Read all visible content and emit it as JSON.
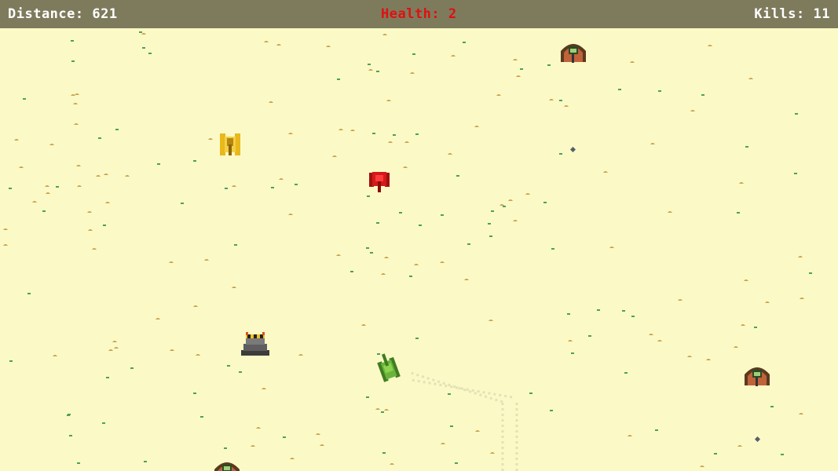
{
  "hud": {
    "distance_label": "Distance:",
    "distance_value": "621",
    "health_label": "Health:",
    "health_value": "2",
    "kills_label": "Kills:",
    "kills_value": "11"
  },
  "colors": {
    "sand": "#fbf9c6",
    "hud_bar": "#7e7b5d",
    "hud_text": "#ffffff",
    "health_text": "#e01010",
    "player_tank": "#6ab43c",
    "enemy_red_tank": "#d21a1a",
    "enemy_yellow_tank": "#e8b81c",
    "bunker": "#5a3a1e",
    "barricade": "#555555"
  },
  "entities": {
    "player": {
      "icon": "green-player-tank-icon"
    },
    "enemies": [
      {
        "icon": "red-enemy-tank-icon"
      },
      {
        "icon": "yellow-enemy-tank-icon"
      }
    ],
    "bunkers": [
      {
        "icon": "soldier-bunker-icon"
      },
      {
        "icon": "soldier-bunker-icon"
      },
      {
        "icon": "soldier-bunker-icon"
      }
    ],
    "obstacles": [
      {
        "icon": "striped-barricade-icon"
      }
    ],
    "mines": [
      {
        "icon": "landmine-icon"
      },
      {
        "icon": "landmine-icon"
      }
    ]
  }
}
